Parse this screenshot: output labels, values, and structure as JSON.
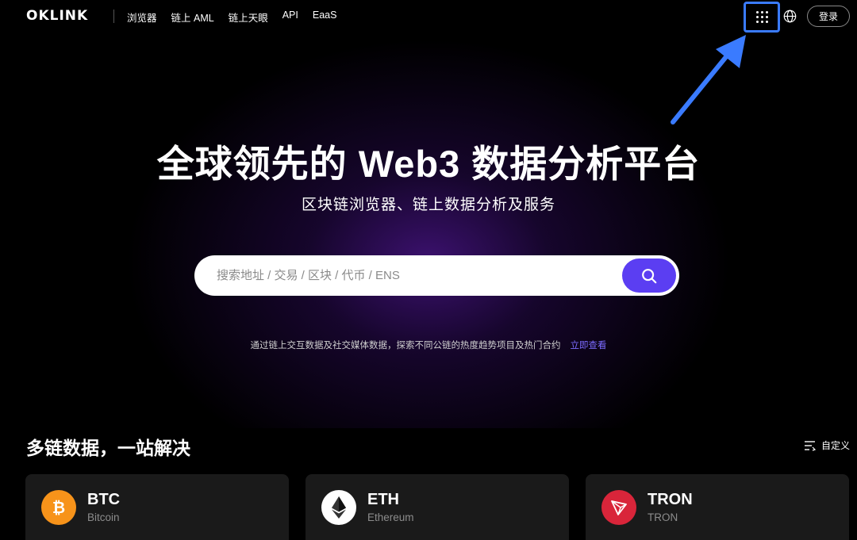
{
  "header": {
    "logo": "OKLINK",
    "nav": [
      "浏览器",
      "链上 AML",
      "链上天眼",
      "API",
      "EaaS"
    ],
    "login": "登录",
    "icons": {
      "apps": "apps-grid-icon",
      "language": "globe-icon"
    }
  },
  "hero": {
    "title": "全球领先的 Web3 数据分析平台",
    "subtitle": "区块链浏览器、链上数据分析及服务",
    "search_placeholder": "搜索地址 / 交易 / 区块 / 代币 / ENS",
    "hint": "通过链上交互数据及社交媒体数据，探索不同公链的热度趋势项目及热门合约",
    "hint_link": "立即查看"
  },
  "section": {
    "title": "多链数据，一站解决",
    "customize": "自定义"
  },
  "chains": [
    {
      "symbol": "BTC",
      "name": "Bitcoin",
      "color": "#f7931a",
      "icon": "bitcoin-icon"
    },
    {
      "symbol": "ETH",
      "name": "Ethereum",
      "color": "#ffffff",
      "icon": "ethereum-icon"
    },
    {
      "symbol": "TRON",
      "name": "TRON",
      "color": "#d9253a",
      "icon": "tron-icon"
    }
  ],
  "colors": {
    "accent": "#5b3ef2",
    "highlight": "#3a7bff",
    "link": "#7c6cff"
  }
}
